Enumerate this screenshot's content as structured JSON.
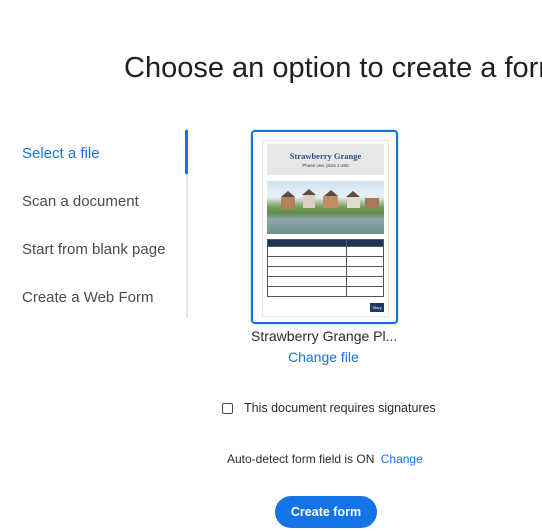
{
  "page": {
    "title": "Choose an option to create a form"
  },
  "nav": {
    "items": [
      {
        "label": "Select a file",
        "active": true
      },
      {
        "label": "Scan a document",
        "active": false
      },
      {
        "label": "Start from blank page",
        "active": false
      },
      {
        "label": "Create a Web Form",
        "active": false
      }
    ]
  },
  "file": {
    "name": "Strawberry Grange Pl...",
    "change_label": "Change file",
    "preview": {
      "title": "Strawberry Grange",
      "subtitle": "Phase one, plots 1-200",
      "logo_text": "Story"
    }
  },
  "signatures": {
    "checked": false,
    "label": "This document requires signatures"
  },
  "autodetect": {
    "text": "Auto-detect form field is ON",
    "change_label": "Change"
  },
  "actions": {
    "create_label": "Create form"
  },
  "colors": {
    "accent": "#1473e6"
  }
}
